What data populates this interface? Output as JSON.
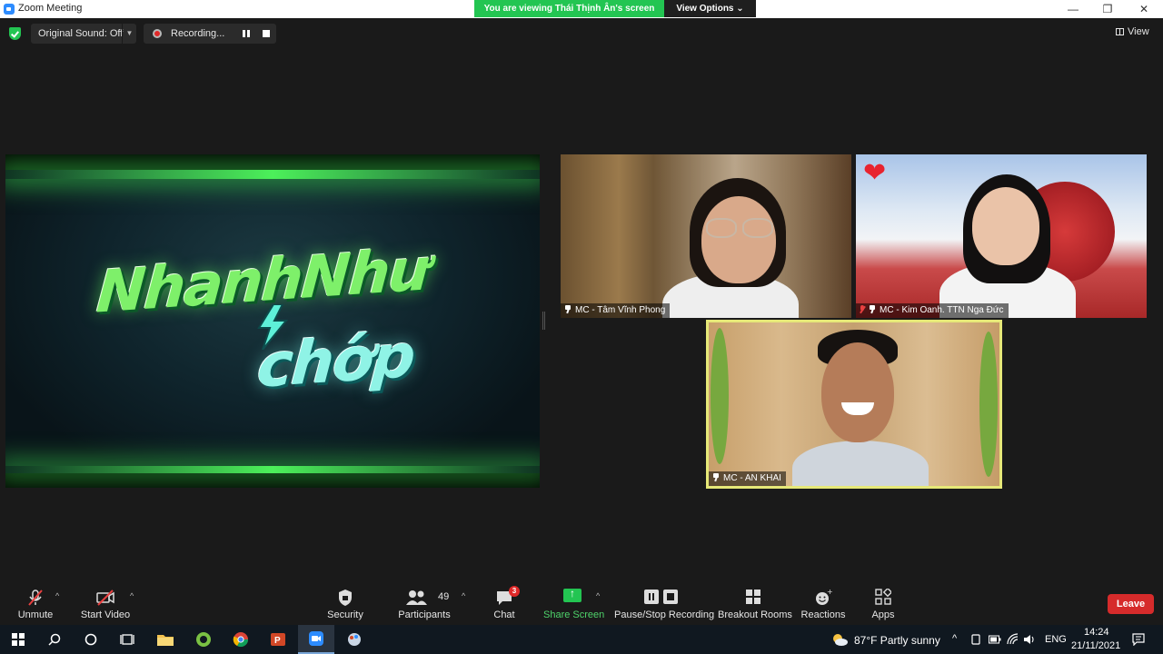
{
  "window": {
    "title": "Zoom Meeting",
    "viewing_banner": "You are viewing Thái Thịnh Ân's screen",
    "view_options": "View Options ⌄",
    "minimize": "—",
    "maximize": "❐",
    "close": "✕"
  },
  "topbar": {
    "original_sound": "Original Sound: Off",
    "recording": "Recording...",
    "view": "View"
  },
  "shared_screen": {
    "logo_line1": "NhanhNhư",
    "logo_line2": "chớp"
  },
  "participants": [
    {
      "label": "MC - Tâm Vĩnh Phong"
    },
    {
      "label": "MC - Kim Oanh. TTN Nga Đức"
    },
    {
      "label": "MC - AN KHAI"
    }
  ],
  "toolbar": {
    "unmute": "Unmute",
    "start_video": "Start Video",
    "security": "Security",
    "participants": "Participants",
    "participants_count": "49",
    "chat": "Chat",
    "chat_badge": "3",
    "share_screen": "Share Screen",
    "pause_stop_recording": "Pause/Stop Recording",
    "breakout_rooms": "Breakout Rooms",
    "reactions": "Reactions",
    "apps": "Apps",
    "leave": "Leave"
  },
  "taskbar": {
    "weather": "87°F  Partly sunny",
    "language": "ENG",
    "time": "14:24",
    "date": "21/11/2021"
  },
  "colors": {
    "accent_green": "#23c552",
    "leave_red": "#d62b2b",
    "active_speaker": "#e6e878"
  }
}
